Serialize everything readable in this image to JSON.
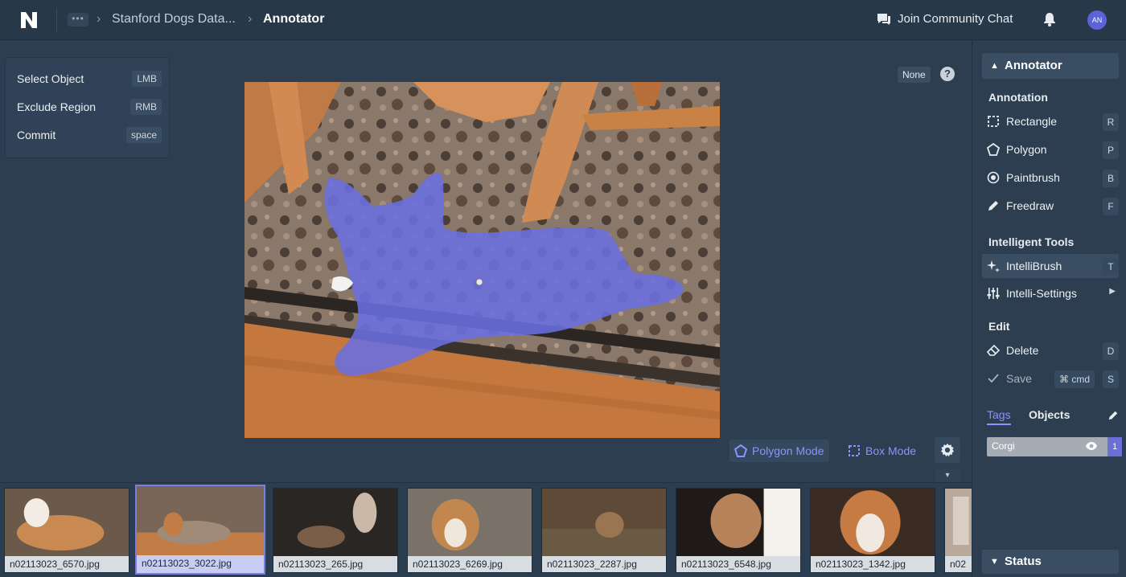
{
  "header": {
    "more_label": "•••",
    "breadcrumb": [
      "Stanford Dogs Data...",
      "Annotator"
    ],
    "community_label": "Join Community Chat",
    "avatar_initials": "AN"
  },
  "shortcuts": [
    {
      "label": "Select Object",
      "key": "LMB"
    },
    {
      "label": "Exclude Region",
      "key": "RMB"
    },
    {
      "label": "Commit",
      "key": "space"
    }
  ],
  "canvas": {
    "label_filter": "None",
    "help_glyph": "?",
    "modes": {
      "polygon": "Polygon Mode",
      "box": "Box Mode"
    },
    "collapse_glyph": "▾"
  },
  "filmstrip": [
    {
      "filename": "n02113023_6570.jpg",
      "selected": false,
      "colors": [
        "#6b5a4a",
        "#c98a52",
        "#f2ece4"
      ]
    },
    {
      "filename": "n02113023_3022.jpg",
      "selected": true,
      "colors": [
        "#7a6656",
        "#c27d47",
        "#a08a78"
      ]
    },
    {
      "filename": "n02113023_265.jpg",
      "selected": false,
      "colors": [
        "#2a2624",
        "#7a5e48",
        "#c9b9a6"
      ]
    },
    {
      "filename": "n02113023_6269.jpg",
      "selected": false,
      "colors": [
        "#7a7168",
        "#c2874e",
        "#efe7dc"
      ]
    },
    {
      "filename": "n02113023_2287.jpg",
      "selected": false,
      "colors": [
        "#5e4a36",
        "#9a7650",
        "#6b5a43"
      ]
    },
    {
      "filename": "n02113023_6548.jpg",
      "selected": false,
      "colors": [
        "#1f1a17",
        "#b6825a",
        "#f4f1ed"
      ]
    },
    {
      "filename": "n02113023_1342.jpg",
      "selected": false,
      "colors": [
        "#3a2c22",
        "#c57b43",
        "#f1e9e0"
      ]
    },
    {
      "filename": "n02",
      "selected": false,
      "colors": [
        "#b9a99a",
        "#8f7d6c",
        "#d9cfc4"
      ]
    }
  ],
  "panel": {
    "title": "Annotator",
    "section_annotation": "Annotation",
    "annotation_tools": [
      {
        "label": "Rectangle",
        "key": "R",
        "icon": "rectangle-icon"
      },
      {
        "label": "Polygon",
        "key": "P",
        "icon": "polygon-icon"
      },
      {
        "label": "Paintbrush",
        "key": "B",
        "icon": "paintbrush-icon"
      },
      {
        "label": "Freedraw",
        "key": "F",
        "icon": "pencil-icon"
      }
    ],
    "section_intelligent": "Intelligent Tools",
    "intellibrush": {
      "label": "IntelliBrush",
      "key": "T"
    },
    "intelli_settings": {
      "label": "Intelli-Settings"
    },
    "section_edit": "Edit",
    "delete": {
      "label": "Delete",
      "key": "D"
    },
    "save": {
      "label": "Save",
      "key_modifier": "cmd",
      "key": "S"
    },
    "tabs": {
      "tags": "Tags",
      "objects": "Objects"
    },
    "tag": {
      "name": "Corgi",
      "count": "1"
    },
    "status_title": "Status"
  },
  "colors": {
    "accent": "#8b93ff",
    "mask": "#6a6ee0",
    "background": "#2c3e50"
  }
}
